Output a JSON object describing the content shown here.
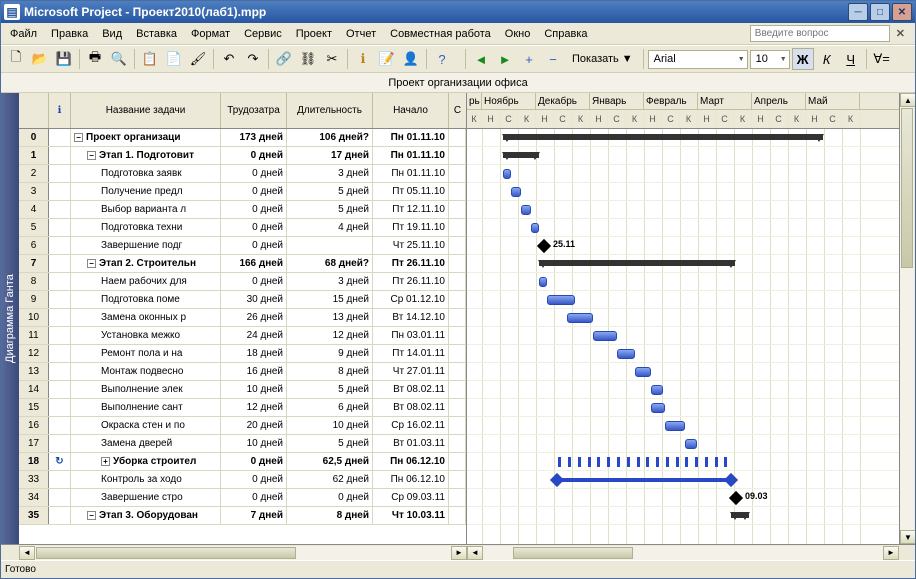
{
  "app": {
    "title": "Microsoft Project - Проект2010(лаб1).mpp"
  },
  "help_placeholder": "Введите вопрос",
  "menu": [
    "Файл",
    "Правка",
    "Вид",
    "Вставка",
    "Формат",
    "Сервис",
    "Проект",
    "Отчет",
    "Совместная работа",
    "Окно",
    "Справка"
  ],
  "toolbar": {
    "show_label": "Показать",
    "font": "Arial",
    "size": "10"
  },
  "proj_title": "Проект организации офиса",
  "sidebar_label": "Диаграмма Ганта",
  "columns": {
    "indicator": "",
    "info": "",
    "name": "Название задачи",
    "work": "Трудозатра",
    "dur": "Длительность",
    "start": "Начало",
    "rest": "С"
  },
  "months": [
    "рь",
    "Ноябрь",
    "Декабрь",
    "Январь",
    "Февраль",
    "Март",
    "Апрель",
    "Май"
  ],
  "weeks_letters": [
    "Н",
    "С",
    "К"
  ],
  "week_partial": "К",
  "rows": [
    {
      "id": "0",
      "level": 0,
      "bold": true,
      "expandable": "-",
      "name": "Проект организаци",
      "work": "173 дней",
      "dur": "106 дней?",
      "start": "Пн 01.11.10",
      "type": "summary",
      "gx": 36,
      "gw": 320
    },
    {
      "id": "1",
      "level": 1,
      "bold": true,
      "expandable": "-",
      "name": "Этап 1. Подготовит",
      "work": "0 дней",
      "dur": "17 дней",
      "start": "Пн 01.11.10",
      "type": "summary",
      "gx": 36,
      "gw": 36
    },
    {
      "id": "2",
      "level": 2,
      "name": "Подготовка заявк",
      "work": "0 дней",
      "dur": "3 дней",
      "start": "Пн 01.11.10",
      "type": "task",
      "gx": 36,
      "gw": 8
    },
    {
      "id": "3",
      "level": 2,
      "name": "Получение предл",
      "work": "0 дней",
      "dur": "5 дней",
      "start": "Пт 05.11.10",
      "type": "task",
      "gx": 44,
      "gw": 10
    },
    {
      "id": "4",
      "level": 2,
      "name": "Выбор варианта л",
      "work": "0 дней",
      "dur": "5 дней",
      "start": "Пт 12.11.10",
      "type": "task",
      "gx": 54,
      "gw": 10
    },
    {
      "id": "5",
      "level": 2,
      "name": "Подготовка техни",
      "work": "0 дней",
      "dur": "4 дней",
      "start": "Пт 19.11.10",
      "type": "task",
      "gx": 64,
      "gw": 8
    },
    {
      "id": "6",
      "level": 2,
      "name": "Завершение подг",
      "work": "0 дней",
      "dur": "",
      "start": "Чт 25.11.10",
      "type": "milestone",
      "gx": 72,
      "label": "25.11"
    },
    {
      "id": "7",
      "level": 1,
      "bold": true,
      "expandable": "-",
      "name": "Этап 2. Строительн",
      "work": "166 дней",
      "dur": "68 дней?",
      "start": "Пт 26.11.10",
      "type": "summary",
      "gx": 72,
      "gw": 196
    },
    {
      "id": "8",
      "level": 2,
      "name": "Наем рабочих для",
      "work": "0 дней",
      "dur": "3 дней",
      "start": "Пт 26.11.10",
      "type": "task",
      "gx": 72,
      "gw": 8
    },
    {
      "id": "9",
      "level": 2,
      "name": "Подготовка поме",
      "work": "30 дней",
      "dur": "15 дней",
      "start": "Ср 01.12.10",
      "type": "task",
      "gx": 80,
      "gw": 28
    },
    {
      "id": "10",
      "level": 2,
      "name": "Замена оконных р",
      "work": "26 дней",
      "dur": "13 дней",
      "start": "Вт 14.12.10",
      "type": "task",
      "gx": 100,
      "gw": 26
    },
    {
      "id": "11",
      "level": 2,
      "name": "Установка межко",
      "work": "24 дней",
      "dur": "12 дней",
      "start": "Пн 03.01.11",
      "type": "task",
      "gx": 126,
      "gw": 24
    },
    {
      "id": "12",
      "level": 2,
      "name": "Ремонт пола и на",
      "work": "18 дней",
      "dur": "9 дней",
      "start": "Пт 14.01.11",
      "type": "task",
      "gx": 150,
      "gw": 18
    },
    {
      "id": "13",
      "level": 2,
      "name": "Монтаж подвесно",
      "work": "16 дней",
      "dur": "8 дней",
      "start": "Чт 27.01.11",
      "type": "task",
      "gx": 168,
      "gw": 16
    },
    {
      "id": "14",
      "level": 2,
      "name": "Выполнение элек",
      "work": "10 дней",
      "dur": "5 дней",
      "start": "Вт 08.02.11",
      "type": "task",
      "gx": 184,
      "gw": 12
    },
    {
      "id": "15",
      "level": 2,
      "name": "Выполнение сант",
      "work": "12 дней",
      "dur": "6 дней",
      "start": "Вт 08.02.11",
      "type": "task",
      "gx": 184,
      "gw": 14
    },
    {
      "id": "16",
      "level": 2,
      "name": "Окраска стен и по",
      "work": "20 дней",
      "dur": "10 дней",
      "start": "Ср 16.02.11",
      "type": "task",
      "gx": 198,
      "gw": 20
    },
    {
      "id": "17",
      "level": 2,
      "name": "Замена дверей",
      "work": "10 дней",
      "dur": "5 дней",
      "start": "Вт 01.03.11",
      "type": "task",
      "gx": 218,
      "gw": 12
    },
    {
      "id": "18",
      "level": 2,
      "bold": true,
      "expandable": "+",
      "icon": "recurring",
      "name": "Уборка строител",
      "work": "0 дней",
      "dur": "62,5 дней",
      "start": "Пн 06.12.10",
      "type": "dashed",
      "gx": 88,
      "gw": 176
    },
    {
      "id": "33",
      "level": 2,
      "name": "Контроль за ходо",
      "work": "0 дней",
      "dur": "62 дней",
      "start": "Пн 06.12.10",
      "type": "line",
      "gx": 88,
      "gw": 176
    },
    {
      "id": "34",
      "level": 2,
      "name": "Завершение стро",
      "work": "0 дней",
      "dur": "0 дней",
      "start": "Ср 09.03.11",
      "type": "milestone",
      "gx": 264,
      "label": "09.03"
    },
    {
      "id": "35",
      "level": 1,
      "bold": true,
      "expandable": "-",
      "name": "Этап 3. Оборудован",
      "work": "7 дней",
      "dur": "8 дней",
      "start": "Чт 10.03.11",
      "type": "summary",
      "gx": 264,
      "gw": 18
    }
  ],
  "status": "Готово",
  "chart_data": {
    "type": "gantt",
    "title": "Проект организации офиса",
    "timescale": {
      "start": "2010-10",
      "end": "2011-05",
      "major": "month",
      "minor": "НСК"
    },
    "tasks_ref": "rows"
  }
}
